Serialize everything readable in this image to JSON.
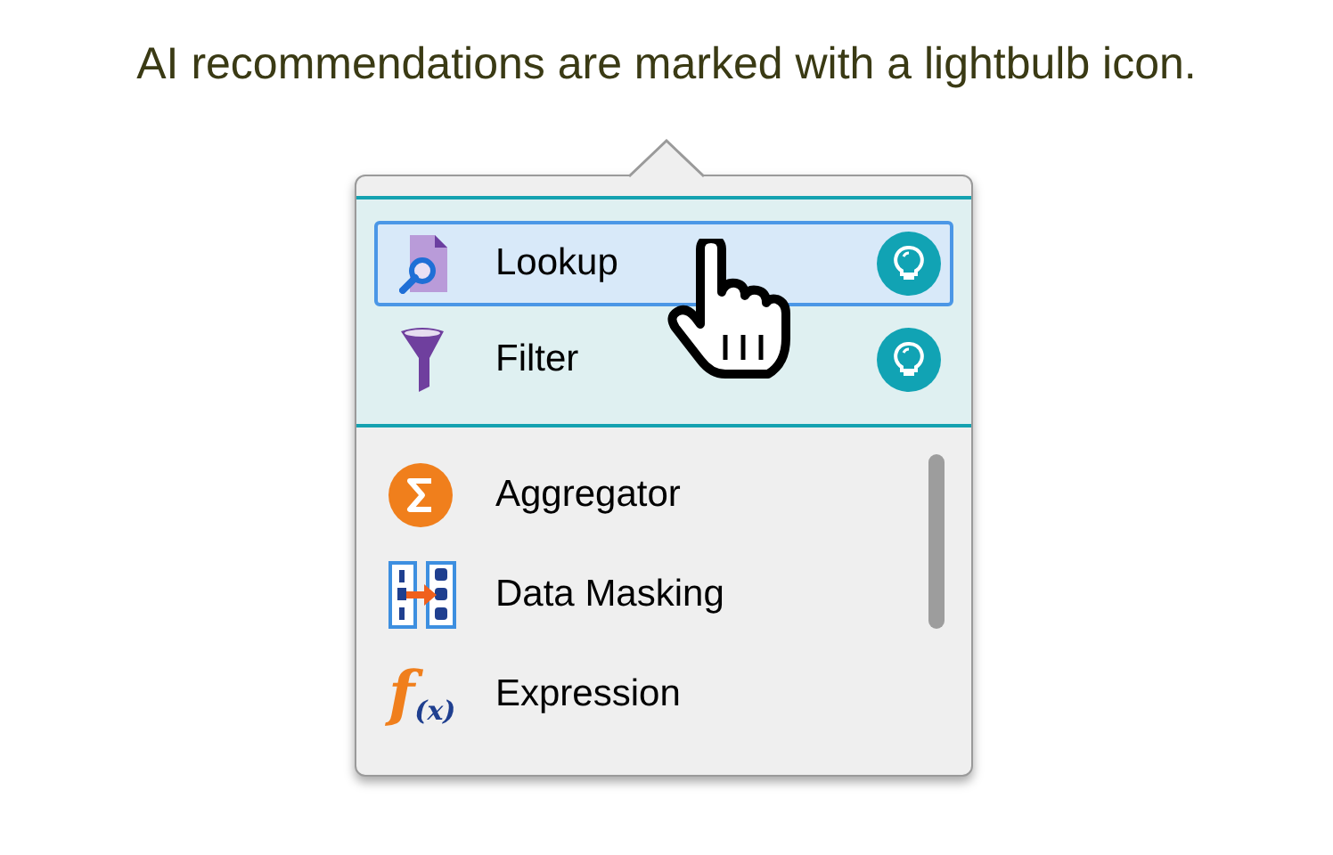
{
  "caption": "AI recommendations are marked with a lightbulb icon.",
  "recommended": [
    {
      "label": "Lookup",
      "selected": true
    },
    {
      "label": "Filter",
      "selected": false
    }
  ],
  "items": [
    {
      "label": "Aggregator"
    },
    {
      "label": "Data Masking"
    },
    {
      "label": "Expression",
      "icon_glyph": "f",
      "icon_sub": "(x)"
    }
  ]
}
